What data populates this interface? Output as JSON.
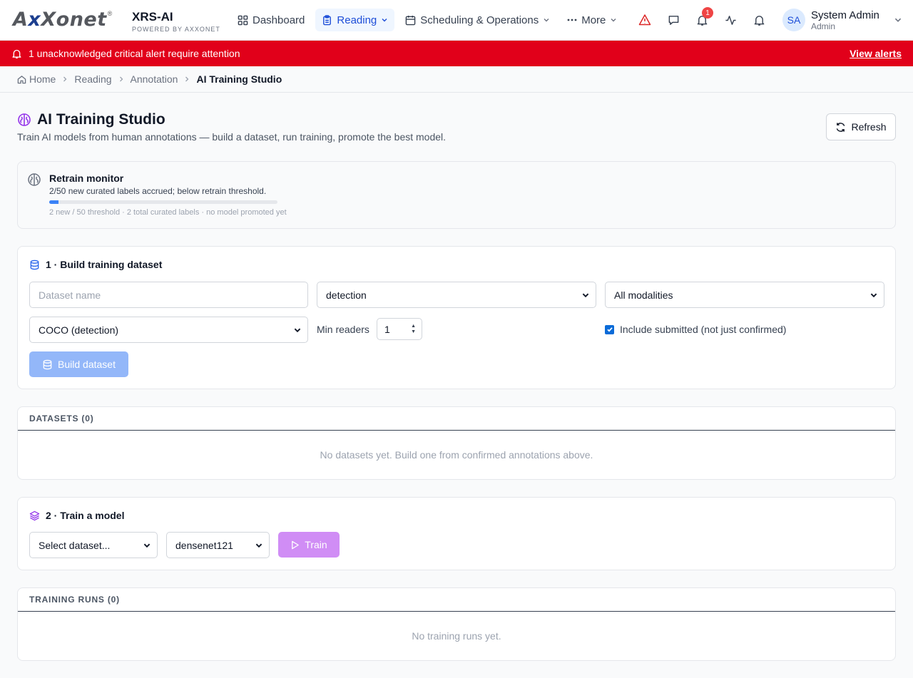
{
  "brand": {
    "logo_text": "AxXonet",
    "app_name": "XRS-AI",
    "powered_by": "POWERED BY AXXONET"
  },
  "nav": {
    "items": [
      {
        "label": "Dashboard",
        "icon": "grid-icon"
      },
      {
        "label": "Reading",
        "icon": "clipboard-icon",
        "active": true
      },
      {
        "label": "Scheduling & Operations",
        "icon": "calendar-icon"
      },
      {
        "label": "More",
        "icon": "dots-icon"
      }
    ],
    "notifications_count": "1",
    "user": {
      "initials": "SA",
      "name": "System Admin",
      "role": "Admin"
    }
  },
  "alert": {
    "message": "1 unacknowledged critical alert require attention",
    "action": "View alerts",
    "color": "#e1001a"
  },
  "breadcrumb": {
    "home": "Home",
    "reading": "Reading",
    "annotation": "Annotation",
    "current": "AI Training Studio"
  },
  "page": {
    "title": "AI Training Studio",
    "description": "Train AI models from human annotations — build a dataset, run training, promote the best model.",
    "refresh_label": "Refresh"
  },
  "monitor": {
    "title": "Retrain monitor",
    "text": "2/50 new curated labels accrued; below retrain threshold.",
    "progress_fraction": 0.04,
    "meta": "2 new / 50 threshold · 2 total curated labels · no model promoted yet"
  },
  "build": {
    "title": "1 · Build training dataset",
    "name_placeholder": "Dataset name",
    "task_value": "detection",
    "modality_value": "All modalities",
    "format_value": "COCO (detection)",
    "min_readers_label": "Min readers",
    "min_readers_value": "1",
    "include_submitted_label": "Include submitted (not just confirmed)",
    "include_submitted_checked": true,
    "button_label": "Build dataset"
  },
  "datasets": {
    "header": "DATASETS (0)",
    "empty": "No datasets yet. Build one from confirmed annotations above."
  },
  "train": {
    "title": "2 · Train a model",
    "dataset_value": "Select dataset...",
    "model_value": "densenet121",
    "button_label": "Train"
  },
  "runs": {
    "header": "TRAINING RUNS (0)",
    "empty": "No training runs yet."
  }
}
